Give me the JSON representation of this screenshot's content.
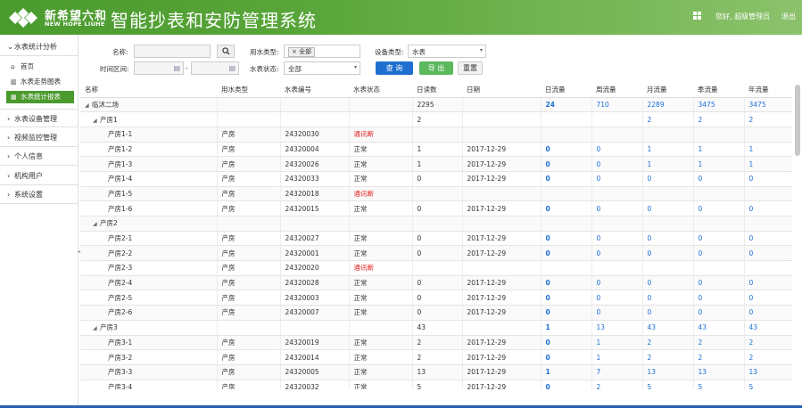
{
  "header": {
    "logo_cn": "新希望六和",
    "logo_en": "NEW HOPE LIUHE",
    "title": "智能抄表和安防管理系统",
    "greeting": "您好, 超级管理员",
    "logout": "退出"
  },
  "sidebar": {
    "groups": [
      {
        "label": "水表统计分析",
        "expanded": true
      },
      {
        "label": "水表设备管理"
      },
      {
        "label": "视频监控管理"
      },
      {
        "label": "个人信息"
      },
      {
        "label": "机构用户"
      },
      {
        "label": "系统设置"
      }
    ],
    "subitems": [
      {
        "label": "首页",
        "icon": "home-icon"
      },
      {
        "label": "水表走势图表",
        "icon": "bar-chart-icon"
      },
      {
        "label": "水表统计报表",
        "icon": "table-icon",
        "active": true
      }
    ]
  },
  "form": {
    "name_label": "名称:",
    "name_value": "",
    "water_type_label": "用水类型:",
    "water_type_tag": "全部",
    "device_type_label": "设备类型:",
    "device_type_value": "水表",
    "time_label": "时间区间:",
    "time_sep": "-",
    "status_label": "水表状态:",
    "status_value": "全部",
    "query_btn": "查 询",
    "export_btn": "导 出",
    "reset_btn": "重置"
  },
  "colors": {
    "header_green": "#4a9a2e",
    "query_blue": "#1f6fd1",
    "export_green": "#5cb85c",
    "alert_red": "#e02020",
    "link_blue": "#1a6fd6"
  },
  "table": {
    "columns": [
      "名称",
      "用水类型",
      "水表编号",
      "水表状态",
      "日读数",
      "日期",
      "日流量",
      "周流量",
      "月流量",
      "季流量",
      "年流量"
    ],
    "rows": [
      {
        "level": 0,
        "tri": "◢",
        "name": "临沭二场",
        "type": "",
        "code": "",
        "status": "",
        "reading": "2295",
        "date": "",
        "day": "24",
        "week": "710",
        "month": "2289",
        "quarter": "3475",
        "year": "3475"
      },
      {
        "level": 1,
        "tri": "◢",
        "name": "产房1",
        "type": "",
        "code": "",
        "status": "",
        "reading": "2",
        "date": "",
        "day": "",
        "week": "",
        "month": "2",
        "quarter": "2",
        "year": "2"
      },
      {
        "level": 2,
        "tri": "",
        "name": "产房1-1",
        "type": "产房",
        "code": "24320030",
        "status": "通讯断",
        "reading": "",
        "date": "",
        "day": "",
        "week": "",
        "month": "",
        "quarter": "",
        "year": ""
      },
      {
        "level": 2,
        "tri": "",
        "name": "产房1-2",
        "type": "产房",
        "code": "24320004",
        "status": "正常",
        "reading": "1",
        "date": "2017-12-29",
        "day": "0",
        "week": "0",
        "month": "1",
        "quarter": "1",
        "year": "1"
      },
      {
        "level": 2,
        "tri": "",
        "name": "产房1-3",
        "type": "产房",
        "code": "24320026",
        "status": "正常",
        "reading": "1",
        "date": "2017-12-29",
        "day": "0",
        "week": "0",
        "month": "1",
        "quarter": "1",
        "year": "1"
      },
      {
        "level": 2,
        "tri": "",
        "name": "产房1-4",
        "type": "产房",
        "code": "24320033",
        "status": "正常",
        "reading": "0",
        "date": "2017-12-29",
        "day": "0",
        "week": "0",
        "month": "0",
        "quarter": "0",
        "year": "0"
      },
      {
        "level": 2,
        "tri": "",
        "name": "产房1-5",
        "type": "产房",
        "code": "24320018",
        "status": "通讯断",
        "reading": "",
        "date": "",
        "day": "",
        "week": "",
        "month": "",
        "quarter": "",
        "year": ""
      },
      {
        "level": 2,
        "tri": "",
        "name": "产房1-6",
        "type": "产房",
        "code": "24320015",
        "status": "正常",
        "reading": "0",
        "date": "2017-12-29",
        "day": "0",
        "week": "0",
        "month": "0",
        "quarter": "0",
        "year": "0"
      },
      {
        "level": 1,
        "tri": "◢",
        "name": "产房2",
        "type": "",
        "code": "",
        "status": "",
        "reading": "",
        "date": "",
        "day": "",
        "week": "",
        "month": "",
        "quarter": "",
        "year": ""
      },
      {
        "level": 2,
        "tri": "",
        "name": "产房2-1",
        "type": "产房",
        "code": "24320027",
        "status": "正常",
        "reading": "0",
        "date": "2017-12-29",
        "day": "0",
        "week": "0",
        "month": "0",
        "quarter": "0",
        "year": "0"
      },
      {
        "level": 2,
        "tri": "",
        "name": "产房2-2",
        "type": "产房",
        "code": "24320001",
        "status": "正常",
        "reading": "0",
        "date": "2017-12-29",
        "day": "0",
        "week": "0",
        "month": "0",
        "quarter": "0",
        "year": "0"
      },
      {
        "level": 2,
        "tri": "",
        "name": "产房2-3",
        "type": "产房",
        "code": "24320020",
        "status": "通讯断",
        "reading": "",
        "date": "",
        "day": "",
        "week": "",
        "month": "",
        "quarter": "",
        "year": ""
      },
      {
        "level": 2,
        "tri": "",
        "name": "产房2-4",
        "type": "产房",
        "code": "24320028",
        "status": "正常",
        "reading": "0",
        "date": "2017-12-29",
        "day": "0",
        "week": "0",
        "month": "0",
        "quarter": "0",
        "year": "0"
      },
      {
        "level": 2,
        "tri": "",
        "name": "产房2-5",
        "type": "产房",
        "code": "24320003",
        "status": "正常",
        "reading": "0",
        "date": "2017-12-29",
        "day": "0",
        "week": "0",
        "month": "0",
        "quarter": "0",
        "year": "0"
      },
      {
        "level": 2,
        "tri": "",
        "name": "产房2-6",
        "type": "产房",
        "code": "24320007",
        "status": "正常",
        "reading": "0",
        "date": "2017-12-29",
        "day": "0",
        "week": "0",
        "month": "0",
        "quarter": "0",
        "year": "0"
      },
      {
        "level": 1,
        "tri": "◢",
        "name": "产房3",
        "type": "",
        "code": "",
        "status": "",
        "reading": "43",
        "date": "",
        "day": "1",
        "week": "13",
        "month": "43",
        "quarter": "43",
        "year": "43"
      },
      {
        "level": 2,
        "tri": "",
        "name": "产房3-1",
        "type": "产房",
        "code": "24320019",
        "status": "正常",
        "reading": "2",
        "date": "2017-12-29",
        "day": "0",
        "week": "1",
        "month": "2",
        "quarter": "2",
        "year": "2"
      },
      {
        "level": 2,
        "tri": "",
        "name": "产房3-2",
        "type": "产房",
        "code": "24320014",
        "status": "正常",
        "reading": "2",
        "date": "2017-12-29",
        "day": "0",
        "week": "1",
        "month": "2",
        "quarter": "2",
        "year": "2"
      },
      {
        "level": 2,
        "tri": "",
        "name": "产房3-3",
        "type": "产房",
        "code": "24320005",
        "status": "正常",
        "reading": "13",
        "date": "2017-12-29",
        "day": "1",
        "week": "7",
        "month": "13",
        "quarter": "13",
        "year": "13"
      },
      {
        "level": 2,
        "tri": "",
        "name": "产房3-4",
        "type": "产房",
        "code": "24320032",
        "status": "正常",
        "reading": "5",
        "date": "2017-12-29",
        "day": "0",
        "week": "2",
        "month": "5",
        "quarter": "5",
        "year": "5"
      }
    ]
  }
}
